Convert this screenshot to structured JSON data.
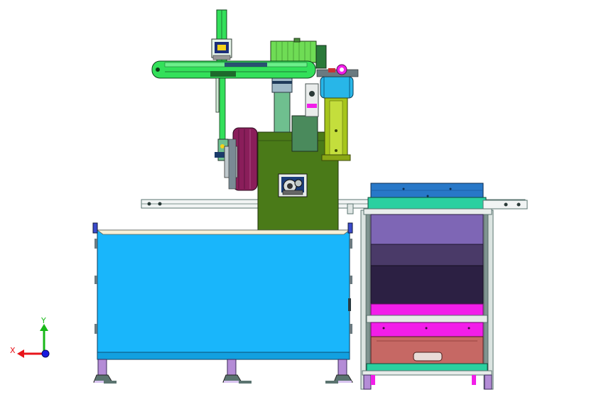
{
  "view": {
    "background": "#ffffff",
    "triad": {
      "x_label": "X",
      "y_label": "Y",
      "x_color": "#e8141b",
      "y_color": "#18b818",
      "z_color": "#1a1ae0"
    }
  },
  "colors": {
    "cabinet": "#19b6fb",
    "frame": "#5b7470",
    "olive": "#4a7a18",
    "gantry": "#33e05a",
    "motor": "#6fdc55",
    "drum": "#8a1e5a",
    "cylinder": "#28b6e8",
    "yellow_green": "#a6c51c",
    "bin_blue": "#2878c8",
    "teal": "#2bd0a0",
    "purple_light": "#7e66b5",
    "purple_mid": "#4a3a68",
    "purple_dark": "#2c2043",
    "magenta": "#f21ee9",
    "salmon": "#c66864"
  }
}
